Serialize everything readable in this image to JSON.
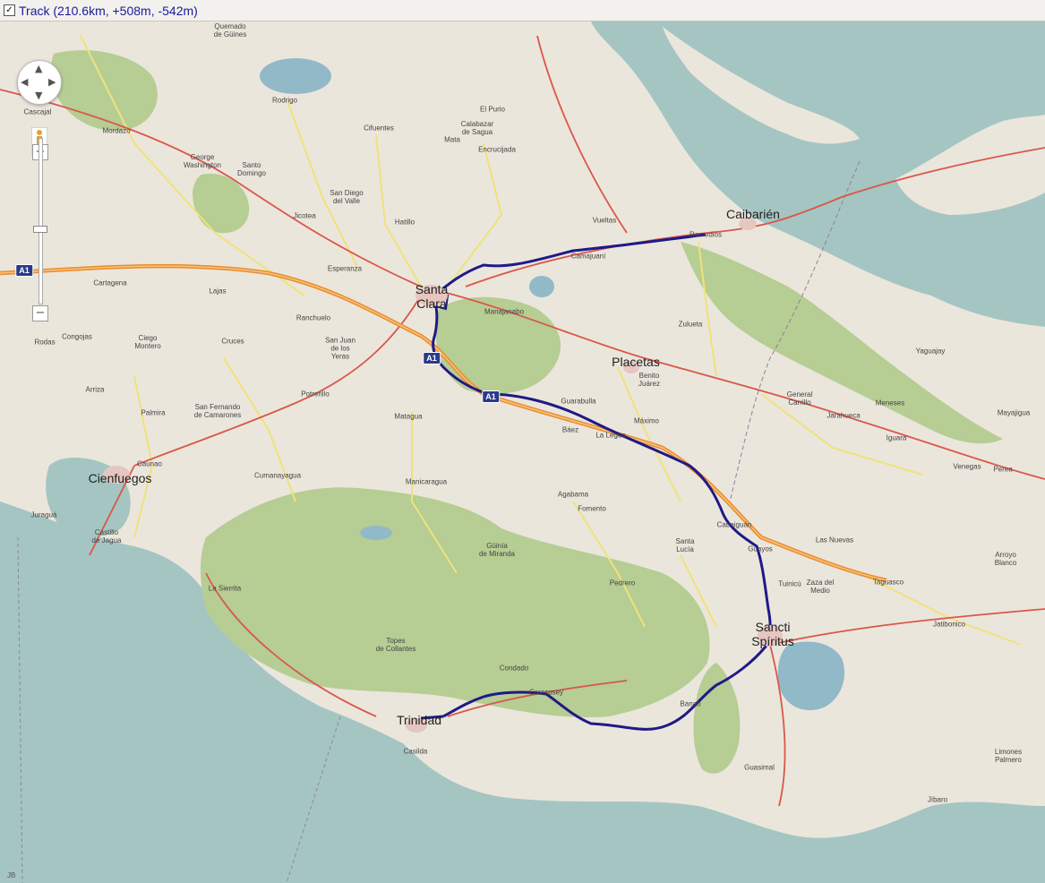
{
  "track_toggle": {
    "checked_glyph": "✓",
    "label": "Track (210.6km, +508m, -542m)"
  },
  "controls": {
    "zoom_in": "+",
    "zoom_out": "−",
    "pan_up": "▲",
    "pan_down": "▼",
    "pan_left": "◀",
    "pan_right": "▶",
    "pegman_icon": "pegman-icon"
  },
  "colors": {
    "sea": "#a5c5c2",
    "land": "#ebe6dc",
    "forest": "#b6cd94",
    "track": "#1f1a86",
    "motorway": "#e98c2f",
    "road_red": "#d9574a",
    "road_yellow": "#f0e27a",
    "lake": "#92b9c8"
  },
  "shields": {
    "a1_west": "A1",
    "a1_santa_clara": "A1",
    "a1_guarabulla": "A1"
  },
  "places": {
    "quemado": "Quemado\nde Güines",
    "cascajal": "Cascajal",
    "mordazo": "Mordazo",
    "rodrigo": "Rodrigo",
    "el_purio": "El Purio",
    "calabazar": "Calabazar\nde Sagua",
    "mata": "Mata",
    "encrucijada": "Encrucijada",
    "cifuentes": "Cifuentes",
    "george_washington": "George\nWashington",
    "santo_domingo": "Santo\nDomingo",
    "san_diego": "San Diego\ndel Valle",
    "jicotea": "Jicotea",
    "hatillo": "Hatillo",
    "vueltas": "Vueltas",
    "caibarien": "Caibarién",
    "remedios": "Remedios",
    "camajuani": "Camajuaní",
    "cartagena": "Cartagena",
    "esperanza": "Esperanza",
    "lajas": "Lajas",
    "santa_clara": "Santa\nClara",
    "manajanabo": "Manajanabo",
    "zulueta": "Zulueta",
    "yaguajay": "Yaguajay",
    "ranchuelo": "Ranchuelo",
    "rodas": "Rodas",
    "congojas": "Congojas",
    "ciego_montero": "Ciego\nMontero",
    "cruces": "Cruces",
    "san_juan": "San Juan\nde los\nYeras",
    "placetas": "Placetas",
    "benito_juarez": "Benito\nJuárez",
    "general_carrillo": "General\nCarrillo",
    "meneses": "Meneses",
    "jarahueca": "Jarahueca",
    "mayajigua": "Mayajigua",
    "arriza": "Arriza",
    "palmira": "Palmira",
    "san_fernando": "San Fernando\nde Camarones",
    "potrerillo": "Potrerillo",
    "matagua": "Matagua",
    "guarabulla": "Guarabulla",
    "baez": "Báez",
    "la_legua": "La Legua",
    "maximo": "Máximo",
    "iguara": "Iguara",
    "venegas": "Venegas",
    "perea": "Perea",
    "caunao": "Caunao",
    "cienfuegos": "Cienfuegos",
    "cumanayagua": "Cumanayagua",
    "manicaragua": "Manicaragua",
    "agabama": "Agabama",
    "fomento": "Fomento",
    "cabaiguan": "Cabaiguán",
    "guayos": "Guayos",
    "las_nuevas": "Las Nuevas",
    "jurangua": "Juraguá",
    "castillo": "Castillo\nde Jagua",
    "guinia": "Güinía\nde Miranda",
    "santa_lucia": "Santa\nLucía",
    "arroyo_blanco": "Arroyo\nBlanco",
    "la_sierrita": "La Sierrita",
    "pedrero": "Pedrero",
    "tuinicu": "Tuinicú",
    "zaza": "Zaza del\nMedio",
    "taguasco": "Taguasco",
    "sancti_spiritus": "Sancti\nSpíritus",
    "jatibonico": "Jatibonico",
    "topes": "Topes\nde Collantes",
    "condado": "Condado",
    "caracusey": "Caracusey",
    "trinidad": "Trinidad",
    "banao": "Banao",
    "casilda": "Casilda",
    "guasimal": "Guasimal",
    "limones": "Limones\nPalmero",
    "jibaro": "Jíbaro"
  },
  "credit": "JB"
}
